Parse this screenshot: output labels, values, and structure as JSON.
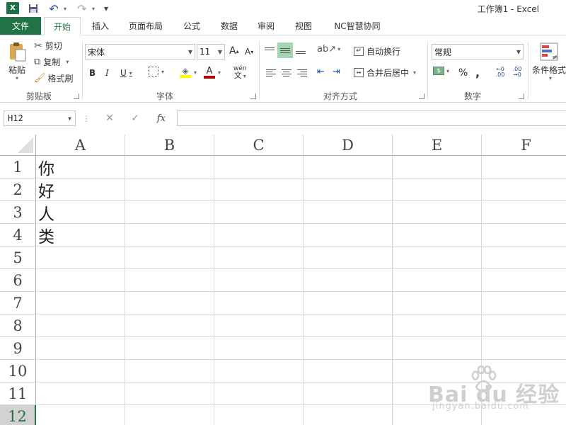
{
  "window": {
    "title": "工作簿1 - Excel",
    "logo_text": "X"
  },
  "qat": {
    "undo": "↶",
    "redo": "↷",
    "customize": "▾"
  },
  "tabs": {
    "file": "文件",
    "items": [
      "开始",
      "插入",
      "页面布局",
      "公式",
      "数据",
      "审阅",
      "视图",
      "NC智慧协同"
    ]
  },
  "ribbon": {
    "clipboard": {
      "paste": "粘贴",
      "cut": "剪切",
      "copy": "复制",
      "format_painter": "格式刷",
      "label": "剪贴板"
    },
    "font": {
      "name": "宋体",
      "size": "11",
      "bold": "B",
      "italic": "I",
      "underline": "U",
      "grow": "A",
      "shrink": "A",
      "font_color_letter": "A",
      "wen": "wén",
      "label": "字体"
    },
    "alignment": {
      "wrap": "自动换行",
      "merge": "合并后居中",
      "label": "对齐方式"
    },
    "number": {
      "format": "常规",
      "percent": "%",
      "comma": ",",
      "inc_dec": "←0 .00",
      "dec_dec": ".00 →0",
      "label": "数字"
    },
    "styles": {
      "conditional": "条件格式"
    }
  },
  "formula_bar": {
    "name_box": "H12",
    "cancel": "✕",
    "confirm": "✓",
    "fx": "fx",
    "value": ""
  },
  "sheet": {
    "columns": [
      "A",
      "B",
      "C",
      "D",
      "E",
      "F"
    ],
    "rows": [
      "1",
      "2",
      "3",
      "4",
      "5",
      "6",
      "7",
      "8",
      "9",
      "10",
      "11",
      "12"
    ],
    "cells": {
      "A1": "你",
      "A2": "好",
      "A3": "人",
      "A4": "类"
    },
    "selected_row": "12"
  },
  "watermark": {
    "text": "Bai du 经验",
    "url": "jingyan.baidu.com"
  },
  "colors": {
    "accent": "#217346",
    "selected_header": "#d2d2d2",
    "highlight": "#a6d5b3"
  },
  "icons": [
    "excel-logo-icon",
    "save-icon",
    "undo-icon",
    "redo-icon",
    "paste-icon",
    "scissors-icon",
    "copy-icon",
    "brush-icon",
    "border-icon",
    "fill-bucket-icon",
    "orientation-icon",
    "wrap-icon",
    "merge-icon",
    "currency-icon",
    "conditional-format-icon"
  ]
}
